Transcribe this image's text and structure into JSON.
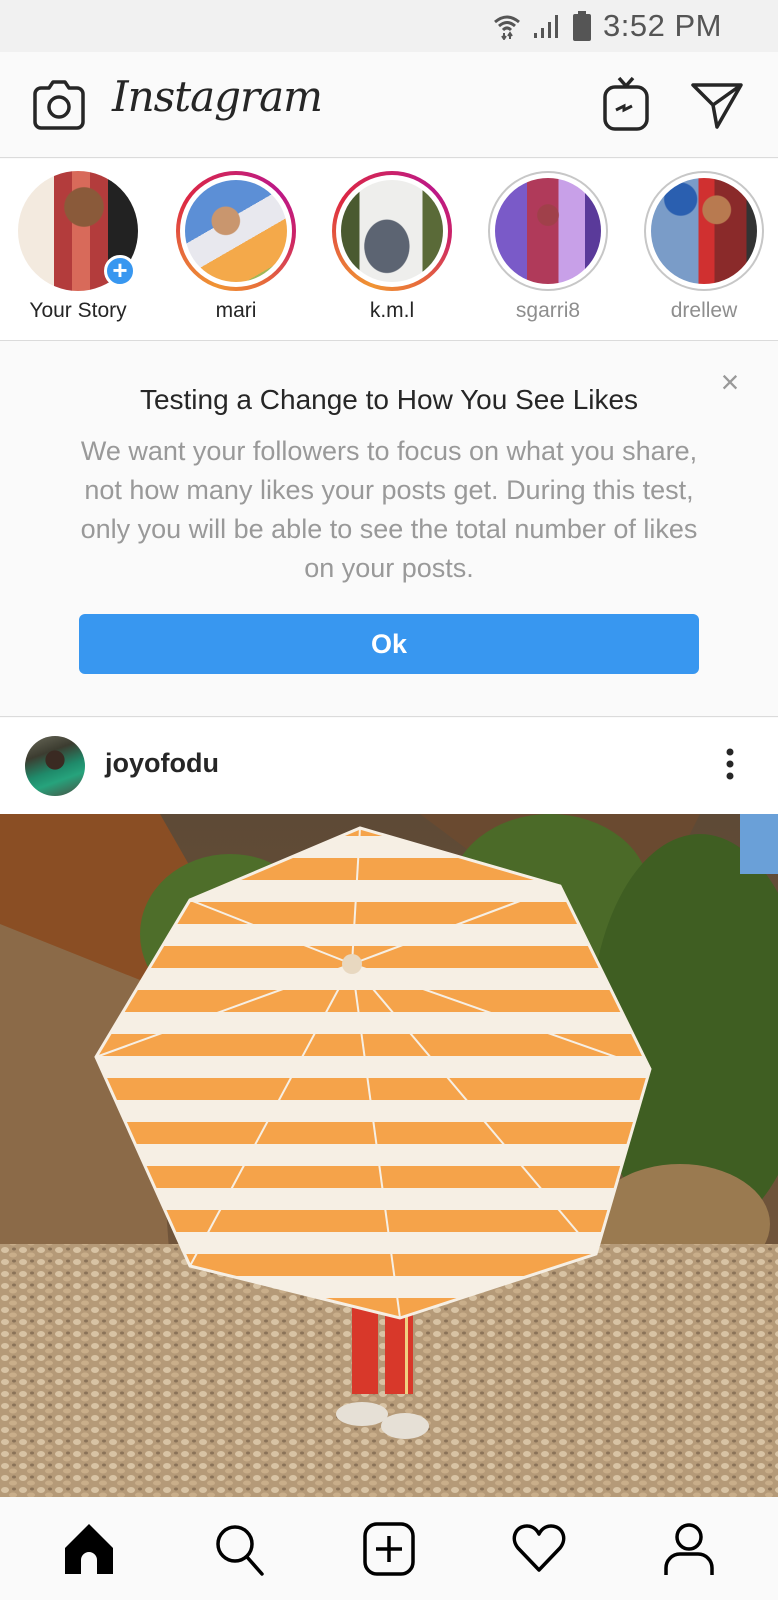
{
  "status_bar": {
    "time": "3:52 PM",
    "icons": [
      "wifi-icon",
      "signal-icon",
      "battery-icon"
    ]
  },
  "header": {
    "logo": "Instagram",
    "left_icon": "camera-icon",
    "right_icons": [
      "igtv-icon",
      "direct-message-icon"
    ]
  },
  "stories": [
    {
      "label": "Your Story",
      "state": "own",
      "has_add_badge": true
    },
    {
      "label": "mari",
      "state": "unseen"
    },
    {
      "label": "k.m.l",
      "state": "unseen"
    },
    {
      "label": "sgarri8",
      "state": "seen"
    },
    {
      "label": "drellew",
      "state": "seen"
    }
  ],
  "notice": {
    "title": "Testing a Change to How You See Likes",
    "body": "We want your followers to focus on what you share, not how many likes your posts get. During this test, only you will be able to see the total number of likes on your posts.",
    "ok_label": "Ok",
    "close_glyph": "×"
  },
  "post": {
    "username": "joyofodu",
    "image_description": "Person hiding behind an orange-and-white striped beach umbrella on a pebble beach"
  },
  "bottom_nav": {
    "items": [
      "home-icon",
      "search-icon",
      "new-post-icon",
      "activity-heart-icon",
      "profile-icon"
    ],
    "active": "home-icon"
  },
  "colors": {
    "accent_blue": "#3897f0",
    "text_primary": "#262626",
    "text_secondary": "#999999",
    "divider": "#dbdbdb",
    "story_seen_ring": "#c7c7c7"
  }
}
